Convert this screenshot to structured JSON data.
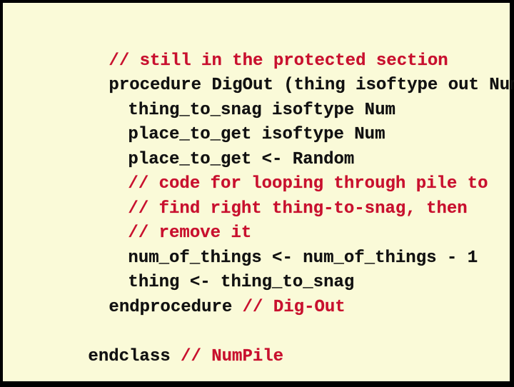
{
  "colors": {
    "background": "#FAFAD8",
    "frame": "#000000",
    "code_text": "#111111",
    "comment_text": "#C8102E"
  },
  "code_lines": [
    {
      "indent": 1,
      "code": "",
      "comment": "// still in the protected section"
    },
    {
      "indent": 1,
      "code": "procedure DigOut (thing isoftype out Num)",
      "comment": ""
    },
    {
      "indent": 2,
      "code": "thing_to_snag isoftype Num",
      "comment": ""
    },
    {
      "indent": 2,
      "code": "place_to_get isoftype Num",
      "comment": ""
    },
    {
      "indent": 2,
      "code": "place_to_get <- Random",
      "comment": ""
    },
    {
      "indent": 2,
      "code": "",
      "comment": "// code for looping through pile to"
    },
    {
      "indent": 2,
      "code": "",
      "comment": "// find right thing-to-snag, then"
    },
    {
      "indent": 2,
      "code": "",
      "comment": "// remove it"
    },
    {
      "indent": 2,
      "code": "num_of_things <- num_of_things - 1",
      "comment": ""
    },
    {
      "indent": 2,
      "code": "thing <- thing_to_snag",
      "comment": ""
    },
    {
      "indent": 1,
      "code": "endprocedure ",
      "comment": "// Dig-Out"
    },
    {
      "indent": 0,
      "code": "endclass ",
      "comment": "// NumPile"
    }
  ]
}
